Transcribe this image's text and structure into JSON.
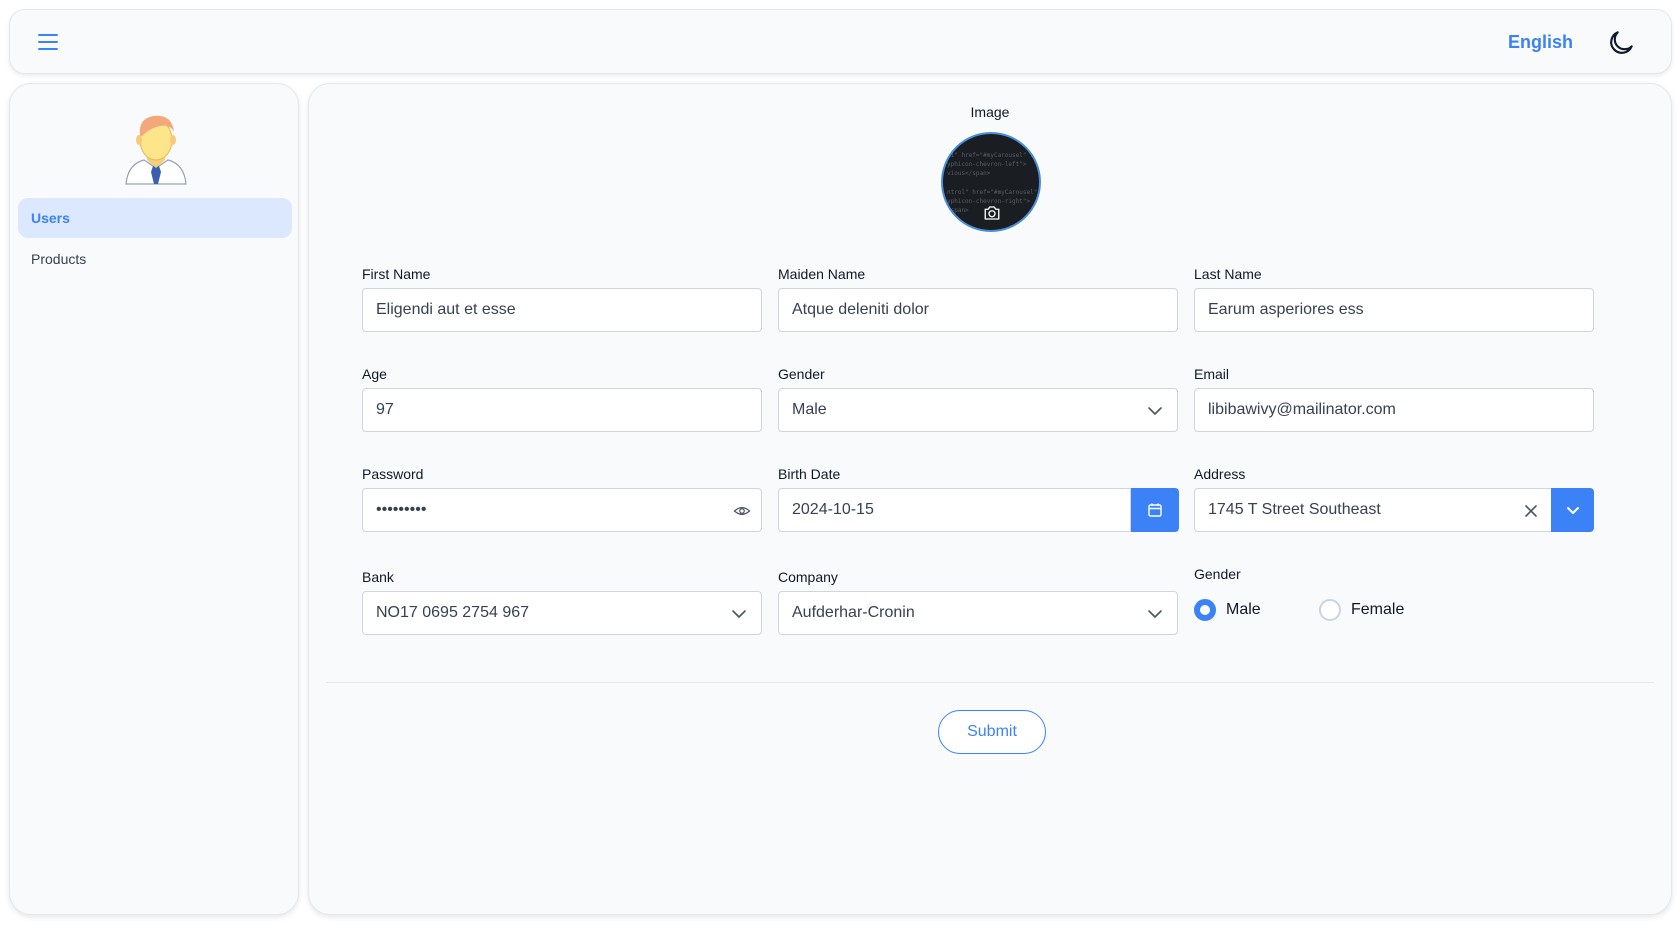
{
  "header": {
    "language": "English"
  },
  "sidebar": {
    "items": [
      {
        "label": "Users",
        "active": true
      },
      {
        "label": "Products",
        "active": false
      }
    ]
  },
  "form": {
    "image_label": "Image",
    "first_name": {
      "label": "First Name",
      "value": "Eligendi aut et esse"
    },
    "maiden_name": {
      "label": "Maiden Name",
      "value": "Atque deleniti dolor"
    },
    "last_name": {
      "label": "Last Name",
      "value": "Earum asperiores ess"
    },
    "age": {
      "label": "Age",
      "value": "97"
    },
    "gender_select": {
      "label": "Gender",
      "value": "Male"
    },
    "email": {
      "label": "Email",
      "value": "libibawivy@mailinator.com"
    },
    "password": {
      "label": "Password",
      "value": "•••••••••"
    },
    "birth_date": {
      "label": "Birth Date",
      "value": "2024-10-15"
    },
    "address": {
      "label": "Address",
      "value": "1745 T Street Southeast"
    },
    "bank": {
      "label": "Bank",
      "value": "NO17 0695 2754 967"
    },
    "company": {
      "label": "Company",
      "value": "Aufderhar-Cronin"
    },
    "gender_radio": {
      "label": "Gender",
      "options": [
        {
          "label": "Male",
          "checked": true
        },
        {
          "label": "Female",
          "checked": false
        }
      ]
    },
    "submit_label": "Submit"
  },
  "colors": {
    "accent": "#3b82f6",
    "active_nav_bg": "#dbe8fd",
    "panel_bg": "#f8fafc"
  }
}
